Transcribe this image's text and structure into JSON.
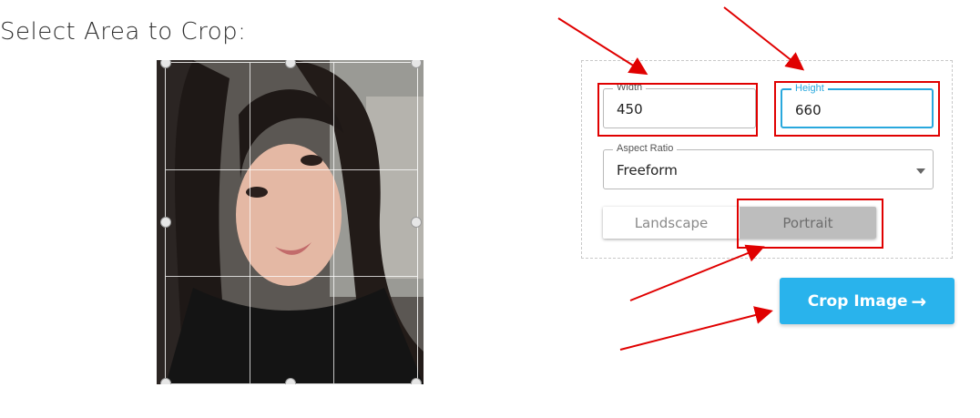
{
  "page": {
    "title": "Select Area to Crop:"
  },
  "crop_settings": {
    "width_label": "Width",
    "width_value": "450",
    "height_label": "Height",
    "height_value": "660",
    "aspect_ratio_label": "Aspect Ratio",
    "aspect_ratio_value": "Freeform",
    "orientation_options": [
      "Landscape",
      "Portrait"
    ],
    "orientation_selected": "Portrait"
  },
  "actions": {
    "crop_button_label": "Crop Image"
  },
  "colors": {
    "accent": "#29b3ec",
    "annotation": "#e00000"
  }
}
